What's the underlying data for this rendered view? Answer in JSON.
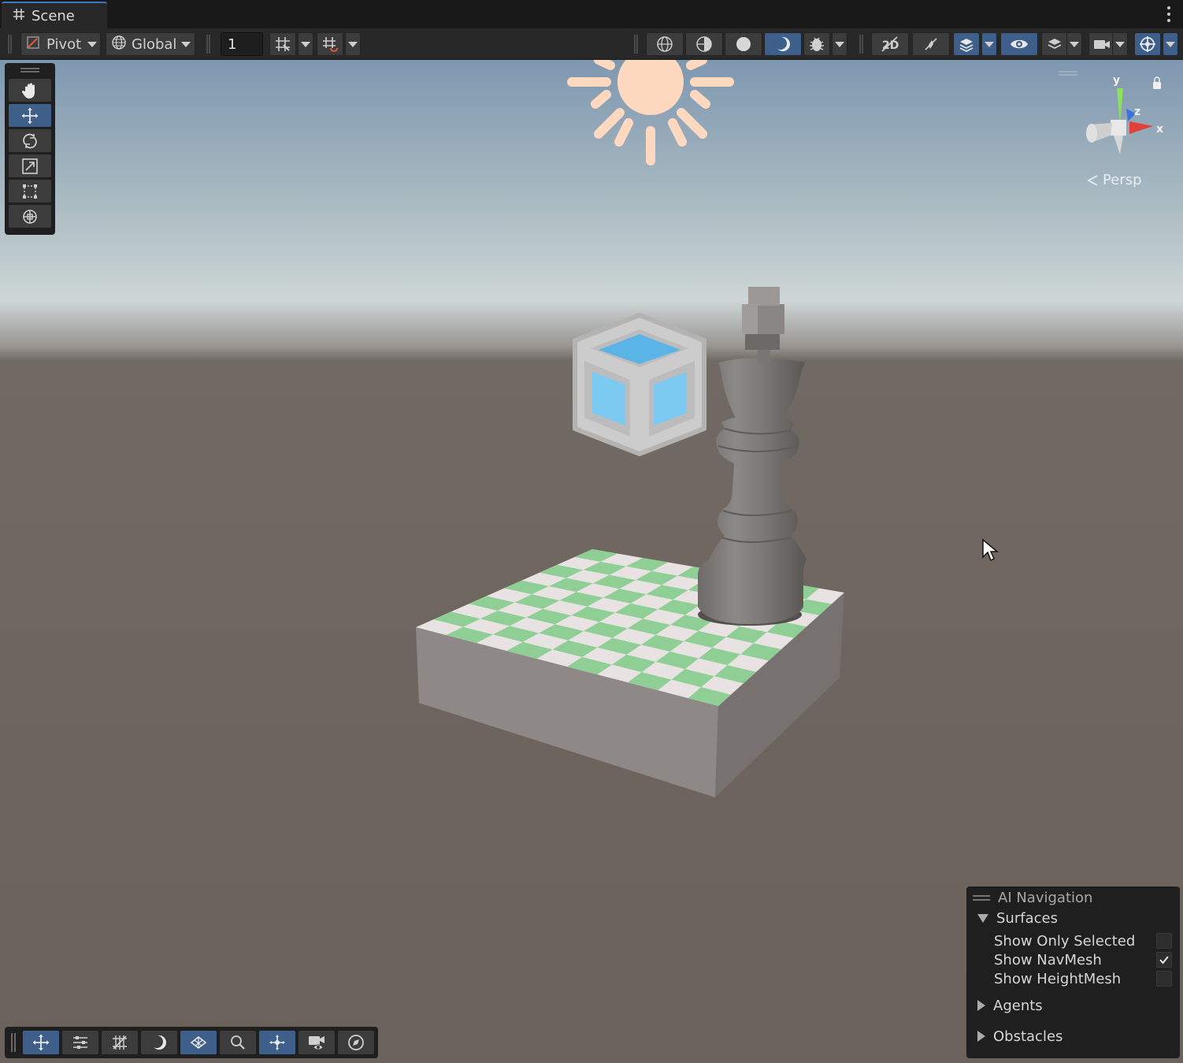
{
  "window": {
    "tab_title": "Scene",
    "tab_icon": "hash-icon",
    "menu_icon": "kebab-menu-icon"
  },
  "toolbar": {
    "pivot_label": "Pivot",
    "global_label": "Global",
    "snap_increment": "1"
  },
  "viewport": {
    "projection_label": "Persp",
    "axes": {
      "y": "y",
      "z": "z",
      "x": "x"
    }
  },
  "ai_navigation": {
    "title": "AI Navigation",
    "sections": {
      "surfaces": {
        "label": "Surfaces",
        "expanded": true,
        "options": {
          "show_only_selected": {
            "label": "Show Only Selected",
            "checked": false
          },
          "show_navmesh": {
            "label": "Show NavMesh",
            "checked": true
          },
          "show_heightmesh": {
            "label": "Show HeightMesh",
            "checked": false
          }
        }
      },
      "agents": {
        "label": "Agents",
        "expanded": false
      },
      "obstacles": {
        "label": "Obstacles",
        "expanded": false
      }
    }
  },
  "colors": {
    "accent": "#3e5f8a",
    "tab_highlight": "#3a79bb",
    "board_green": "#8fcf96",
    "board_white": "#e8e3e2",
    "sun": "#ffd9bf"
  }
}
